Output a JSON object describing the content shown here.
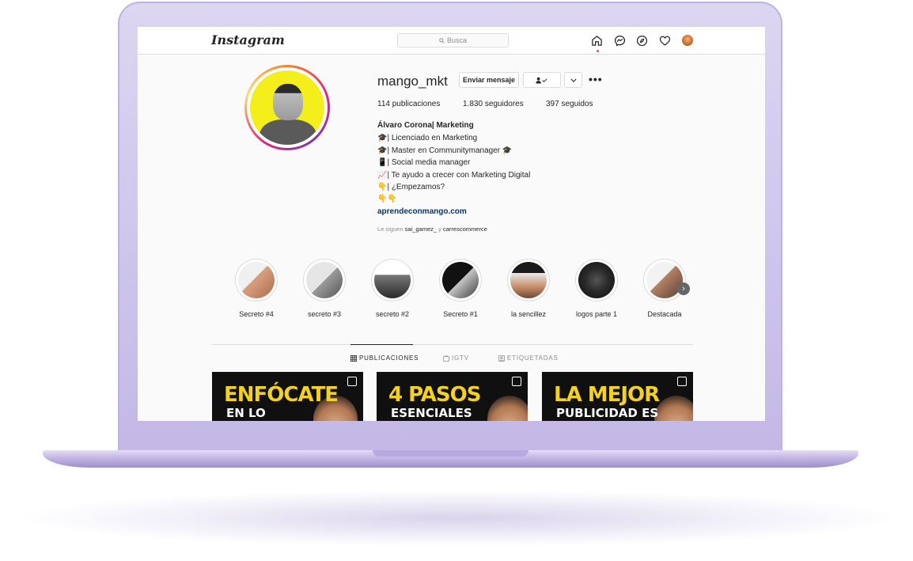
{
  "header": {
    "logo": "Instagram",
    "search_placeholder": "Busca"
  },
  "profile": {
    "username": "mango_mkt",
    "message_button": "Enviar mensaje",
    "stats": [
      {
        "value": "114",
        "label": "publicaciones"
      },
      {
        "value": "1.830",
        "label": "seguidores"
      },
      {
        "value": "397",
        "label": "seguidos"
      }
    ],
    "name": "Álvaro Corona| Marketing",
    "bio": [
      "🎓| Licenciado en Marketing",
      "🎓| Master en Communitymanager 🎓",
      "📱| Social media manager",
      "📈| Te ayudo a crecer con Marketing Digital",
      "👇| ¿Empezamos?",
      "👇👇"
    ],
    "website": "aprendeconmango.com",
    "followed_by_prefix": "Le siguen",
    "followed_by_user1": "sai_gamez_",
    "followed_by_and": "y",
    "followed_by_user2": "carrescommerce"
  },
  "highlights": [
    {
      "label": "Secreto #4"
    },
    {
      "label": "secreto #3"
    },
    {
      "label": "secreto #2"
    },
    {
      "label": "Secreto #1"
    },
    {
      "label": "la sencillez"
    },
    {
      "label": "logos parte 1"
    },
    {
      "label": "Destacada"
    }
  ],
  "tabs": [
    {
      "label": "PUBLICACIONES",
      "active": true
    },
    {
      "label": "IGTV",
      "active": false
    },
    {
      "label": "ETIQUETADAS",
      "active": false
    }
  ],
  "posts": [
    {
      "line1": "ENFÓCATE",
      "line2": "EN LO"
    },
    {
      "line1": "4 PASOS",
      "line2": "ESENCIALES"
    },
    {
      "line1": "LA MEJOR",
      "line2": "PUBLICIDAD ES"
    }
  ],
  "colors": {
    "accent_yellow": "#f3d11c",
    "link": "#00376b",
    "laptop": "#cdc4ec"
  }
}
